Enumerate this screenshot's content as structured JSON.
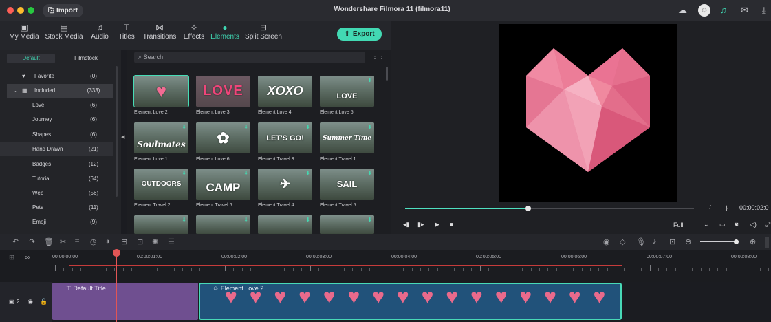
{
  "window": {
    "title": "Wondershare Filmora 11 (filmora11)",
    "import_label": "Import",
    "traffic_lights": [
      "#fe5f57",
      "#febc2e",
      "#28c840"
    ]
  },
  "topbar_icons": [
    "cloud-icon",
    "avatar",
    "headset-icon",
    "mail-icon",
    "download-icon"
  ],
  "tabs": [
    {
      "label": "My Media",
      "icon": "media-icon"
    },
    {
      "label": "Stock Media",
      "icon": "stock-icon"
    },
    {
      "label": "Audio",
      "icon": "music-icon"
    },
    {
      "label": "Titles",
      "icon": "titles-icon"
    },
    {
      "label": "Transitions",
      "icon": "transitions-icon"
    },
    {
      "label": "Effects",
      "icon": "effects-icon"
    },
    {
      "label": "Elements",
      "icon": "elements-icon",
      "active": true
    },
    {
      "label": "Split Screen",
      "icon": "split-screen-icon"
    }
  ],
  "export_label": "Export",
  "subtabs": [
    "Default",
    "Filmstock"
  ],
  "categories": [
    {
      "label": "Favorite",
      "count": "(0)"
    },
    {
      "label": "Included",
      "count": "(333)"
    },
    {
      "label": "Love",
      "count": "(6)"
    },
    {
      "label": "Journey",
      "count": "(6)"
    },
    {
      "label": "Shapes",
      "count": "(6)"
    },
    {
      "label": "Hand Drawn",
      "count": "(21)"
    },
    {
      "label": "Badges",
      "count": "(12)"
    },
    {
      "label": "Tutorial",
      "count": "(64)"
    },
    {
      "label": "Web",
      "count": "(56)"
    },
    {
      "label": "Pets",
      "count": "(11)"
    },
    {
      "label": "Emoji",
      "count": "(9)"
    }
  ],
  "search_placeholder": "Search",
  "elements": [
    {
      "name": "Element Love 2",
      "overlay": "♥"
    },
    {
      "name": "Element Love 3",
      "overlay": "LOVE"
    },
    {
      "name": "Element Love 4",
      "overlay": "XOXO"
    },
    {
      "name": "Element Love 5",
      "overlay": "LOVE"
    },
    {
      "name": "Element Love 1",
      "overlay": "Soulmates"
    },
    {
      "name": "Element Love 6",
      "overlay": "✿"
    },
    {
      "name": "Element Travel 3",
      "overlay": "LET'S GO!"
    },
    {
      "name": "Element Travel 1",
      "overlay": "Summer Time"
    },
    {
      "name": "Element Travel 2",
      "overlay": "OUTDOORS"
    },
    {
      "name": "Element Travel 6",
      "overlay": "CAMP"
    },
    {
      "name": "Element Travel 4",
      "overlay": "✈"
    },
    {
      "name": "Element Travel 5",
      "overlay": "SAIL"
    }
  ],
  "player": {
    "timecode": "00:00:02:0",
    "quality": "Full",
    "progress": 0.43
  },
  "timeline": {
    "times": [
      "00:00:00:00",
      "00:00:01:00",
      "00:00:02:00",
      "00:00:03:00",
      "00:00:04:00",
      "00:00:05:00",
      "00:00:06:00",
      "00:00:07:00",
      "00:00:08:00"
    ],
    "track_label": "2",
    "title_clip": "Default Title",
    "element_clip": "Element Love 2"
  }
}
